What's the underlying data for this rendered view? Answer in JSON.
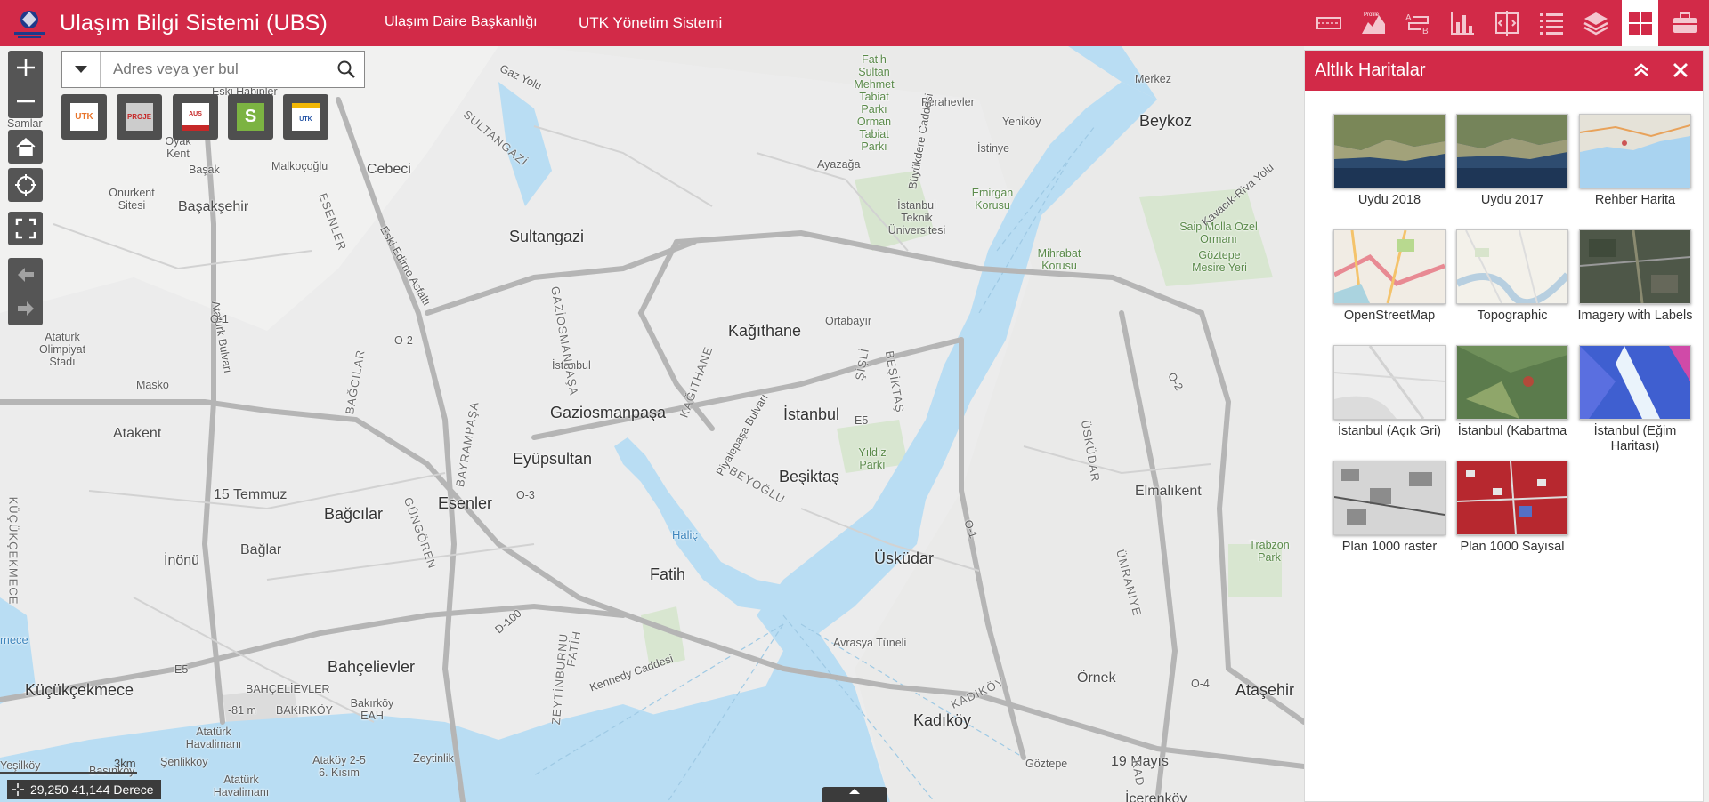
{
  "header": {
    "title": "Ulaşım Bilgi Sistemi (UBS)",
    "nav": [
      "Ulaşım Daire Başkanlığı",
      "UTK Yönetim Sistemi"
    ],
    "tools": [
      {
        "icon": "road-profile-icon"
      },
      {
        "icon": "elevation-profile-icon",
        "label": "Profile"
      },
      {
        "icon": "route-ab-icon"
      },
      {
        "icon": "bar-chart-icon"
      },
      {
        "icon": "swipe-compare-icon"
      },
      {
        "icon": "layer-list-icon"
      },
      {
        "icon": "layers-icon"
      },
      {
        "icon": "basemap-gallery-icon",
        "active": true
      },
      {
        "icon": "toolbox-icon"
      }
    ],
    "accent_color": "#d22a48"
  },
  "search": {
    "placeholder": "Adres veya yer bul"
  },
  "shortcuts": [
    {
      "label": "UTK"
    },
    {
      "label": "PROJE"
    },
    {
      "label": "AUS"
    },
    {
      "label": "S"
    },
    {
      "label": "UTK"
    }
  ],
  "map": {
    "places": [
      {
        "t": "Beykoz",
        "k": "place"
      },
      {
        "t": "Merkez",
        "k": "small"
      },
      {
        "t": "Ferahevler",
        "k": "small"
      },
      {
        "t": "Yeniköy",
        "k": "small"
      },
      {
        "t": "İstinye",
        "k": "small"
      },
      {
        "t": "Ayazağa",
        "k": "small"
      },
      {
        "t": "Fatih Sultan Mehmet Tabiat Parkı",
        "k": "park"
      },
      {
        "t": "Orman Tabiat Parkı",
        "k": "park"
      },
      {
        "t": "Emirgan Korusu",
        "k": "park"
      },
      {
        "t": "İstanbul Teknik Üniversitesi",
        "k": "small"
      },
      {
        "t": "Saip Molla Özel Ormanı",
        "k": "park"
      },
      {
        "t": "Göztepe Mesire Yeri",
        "k": "park"
      },
      {
        "t": "Mihrabat Korusu",
        "k": "park"
      },
      {
        "t": "Malkoçoğlu",
        "k": "small"
      },
      {
        "t": "Cebeci",
        "k": "place"
      },
      {
        "t": "Eski Habipler",
        "k": "small"
      },
      {
        "t": "Samlar",
        "k": "small"
      },
      {
        "t": "Oyak Kent",
        "k": "small"
      },
      {
        "t": "Başak",
        "k": "small"
      },
      {
        "t": "Onurkent Sitesi",
        "k": "small"
      },
      {
        "t": "Başakşehir",
        "k": "place"
      },
      {
        "t": "Sultangazi",
        "k": "big"
      },
      {
        "t": "Kağıthane",
        "k": "big"
      },
      {
        "t": "Ortabayır",
        "k": "small"
      },
      {
        "t": "Atatürk Olimpiyat Stadı",
        "k": "small"
      },
      {
        "t": "Masko",
        "k": "small"
      },
      {
        "t": "Atakent",
        "k": "place"
      },
      {
        "t": "İstanbul",
        "k": "small"
      },
      {
        "t": "Gaziosmanpaşa",
        "k": "big"
      },
      {
        "t": "İstanbul",
        "k": "big"
      },
      {
        "t": "Eyüpsultan",
        "k": "big"
      },
      {
        "t": "Beşiktaş",
        "k": "big"
      },
      {
        "t": "Yıldız Parkı",
        "k": "park"
      },
      {
        "t": "15 Temmuz",
        "k": "place"
      },
      {
        "t": "Bağcılar",
        "k": "big"
      },
      {
        "t": "Esenler",
        "k": "big"
      },
      {
        "t": "Bağlar",
        "k": "place"
      },
      {
        "t": "İnönü",
        "k": "place"
      },
      {
        "t": "Fatih",
        "k": "big"
      },
      {
        "t": "Üsküdar",
        "k": "big"
      },
      {
        "t": "Elmalıkent",
        "k": "place"
      },
      {
        "t": "Trabzon Park",
        "k": "park"
      },
      {
        "t": "Haliç",
        "k": "water"
      },
      {
        "t": "Bahçelievler",
        "k": "big"
      },
      {
        "t": "Küçükçekmece",
        "k": "big"
      },
      {
        "t": "mece",
        "k": "water"
      },
      {
        "t": "BAHÇELİEVLER",
        "k": "small"
      },
      {
        "t": "BAKIRKÖY",
        "k": "small"
      },
      {
        "t": "Bakırköy EAH",
        "k": "small"
      },
      {
        "t": "Atatürk Havalimanı",
        "k": "small"
      },
      {
        "t": "Atatürk Havalimanı",
        "k": "small"
      },
      {
        "t": "-81 m",
        "k": "small"
      },
      {
        "t": "Ataköy 2-5 6. Kısım",
        "k": "small"
      },
      {
        "t": "Zeytinlik",
        "k": "small"
      },
      {
        "t": "Şenlikköy",
        "k": "small"
      },
      {
        "t": "Basınköy",
        "k": "small"
      },
      {
        "t": "Yeşilköy",
        "k": "small"
      },
      {
        "t": "Kadıköy",
        "k": "big"
      },
      {
        "t": "Örnek",
        "k": "place"
      },
      {
        "t": "Ataşehir",
        "k": "big"
      },
      {
        "t": "Göztepe",
        "k": "small"
      },
      {
        "t": "19 Mayıs",
        "k": "place"
      },
      {
        "t": "İçerenköy",
        "k": "place"
      },
      {
        "t": "Avrasya Tüneli",
        "k": "small"
      },
      {
        "t": "Kennedy Caddesi",
        "k": "small"
      },
      {
        "t": "Piyalepaşa Bulvarı",
        "k": "small"
      },
      {
        "t": "Kavacık-Riva Yolu",
        "k": "small"
      },
      {
        "t": "Gaz Yolu",
        "k": "small"
      },
      {
        "t": "Eski Edirne Asfaltı",
        "k": "small"
      },
      {
        "t": "Atatürk Bulvarı",
        "k": "small"
      },
      {
        "t": "Büyükdere Caddesi",
        "k": "small"
      }
    ],
    "roads": [
      {
        "t": "SULTANGAZİ",
        "k": "road"
      },
      {
        "t": "ESENLER",
        "k": "road"
      },
      {
        "t": "GAZİOSMANPAŞA",
        "k": "road"
      },
      {
        "t": "KAĞITHANE",
        "k": "road"
      },
      {
        "t": "ŞİŞLİ",
        "k": "road"
      },
      {
        "t": "BEŞİKTAŞ",
        "k": "road"
      },
      {
        "t": "BAĞCILAR",
        "k": "road"
      },
      {
        "t": "BAYRAMPAŞA",
        "k": "road"
      },
      {
        "t": "GÜNGÖREN",
        "k": "road"
      },
      {
        "t": "BEYOĞLU",
        "k": "road"
      },
      {
        "t": "ZEYTİNBURNU",
        "k": "road"
      },
      {
        "t": "FATİH",
        "k": "road"
      },
      {
        "t": "ÜSKÜDAR",
        "k": "road"
      },
      {
        "t": "ÜMRANİYE",
        "k": "road"
      },
      {
        "t": "KADIKÖY",
        "k": "road"
      },
      {
        "t": "KÜÇÜKÇEKMECE",
        "k": "road"
      },
      {
        "t": "KAD",
        "k": "road"
      },
      {
        "t": "O-1",
        "k": "small"
      },
      {
        "t": "O-2",
        "k": "small"
      },
      {
        "t": "O-3",
        "k": "small"
      },
      {
        "t": "E5",
        "k": "small"
      },
      {
        "t": "E5",
        "k": "small"
      },
      {
        "t": "D-100",
        "k": "small"
      },
      {
        "t": "O-2",
        "k": "small"
      },
      {
        "t": "O-1",
        "k": "small"
      },
      {
        "t": "O-4",
        "k": "small"
      }
    ]
  },
  "basemap_panel": {
    "title": "Altlık Haritalar",
    "items": [
      {
        "label": "Uydu 2018"
      },
      {
        "label": "Uydu 2017"
      },
      {
        "label": "Rehber Harita"
      },
      {
        "label": "OpenStreetMap"
      },
      {
        "label": "Topographic"
      },
      {
        "label": "Imagery with Labels"
      },
      {
        "label": "İstanbul (Açık Gri)"
      },
      {
        "label": "İstanbul (Kabartma"
      },
      {
        "label": "İstanbul (Eğim Haritası)"
      },
      {
        "label": "Plan 1000 raster"
      },
      {
        "label": "Plan 1000 Sayısal"
      }
    ]
  },
  "status": {
    "coordinates": "29,250 41,144 Derece",
    "scale": "3km"
  }
}
